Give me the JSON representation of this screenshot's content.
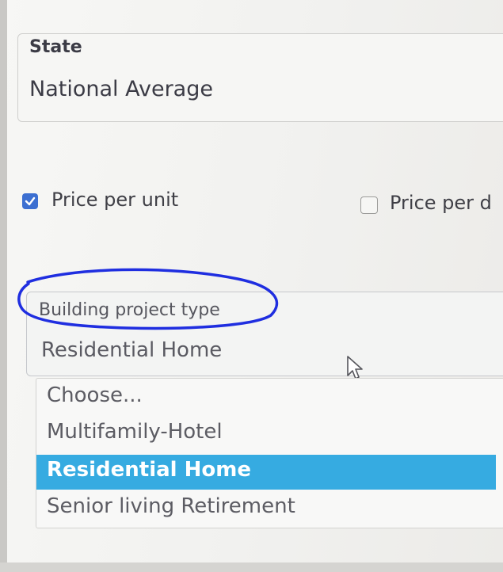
{
  "state_field": {
    "label": "State",
    "value": "National Average"
  },
  "options_row": {
    "price_per_unit": {
      "label": "Price per unit",
      "checked": true
    },
    "price_per_d": {
      "label": "Price per d",
      "checked": false
    }
  },
  "project_type": {
    "label": "Building project type",
    "value": "Residential Home",
    "options": [
      {
        "label": "Choose..."
      },
      {
        "label": "Multifamily-Hotel"
      },
      {
        "label": "Residential Home"
      },
      {
        "label": "Senior living Retirement"
      }
    ],
    "selected_index": 2
  },
  "colors": {
    "accent": "#36abe1",
    "checkbox": "#3c6fd1",
    "annotation": "#1f2ee0"
  }
}
